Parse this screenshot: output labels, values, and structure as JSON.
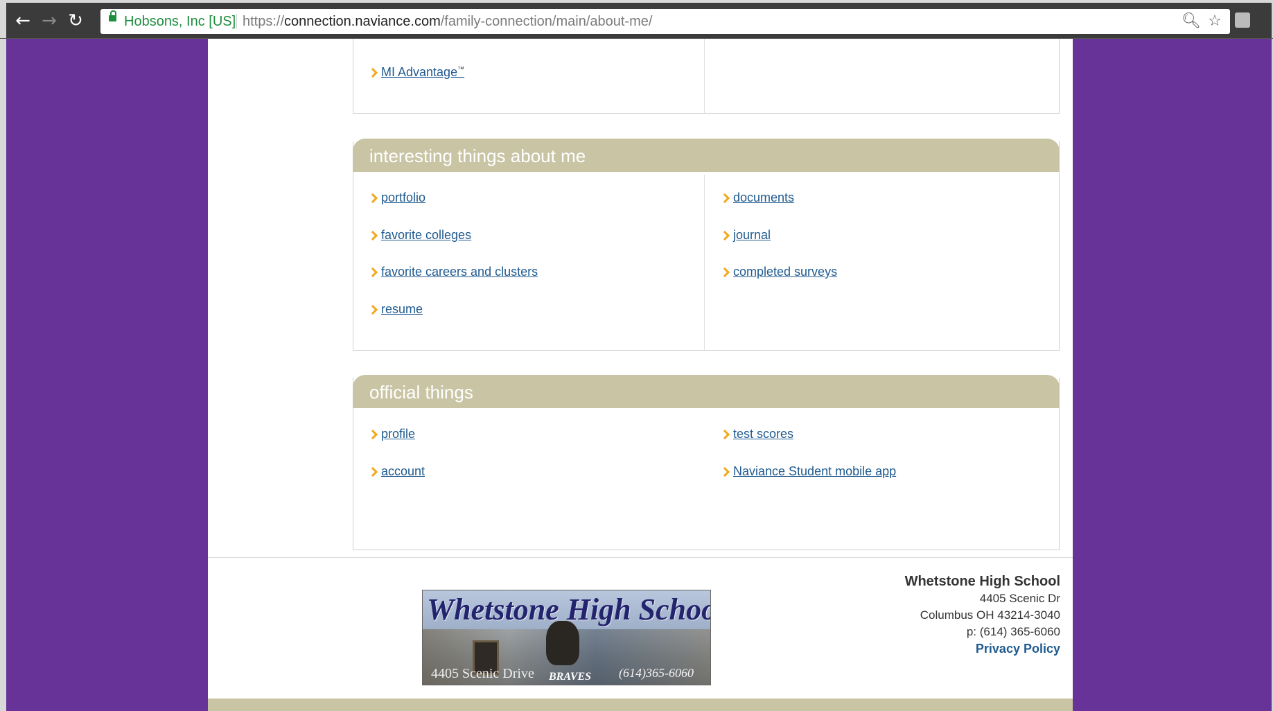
{
  "browser": {
    "back_icon": "arrow-left-icon",
    "forward_icon": "arrow-right-icon",
    "reload_icon": "reload-icon",
    "site_identity": "Hobsons, Inc [US]",
    "url_scheme": "https://",
    "url_host": "connection.naviance.com",
    "url_path": "/family-connection/main/about-me/",
    "zoom_icon": "magnifier-icon",
    "star_icon": "star-icon",
    "extension_icon": "extension-icon"
  },
  "top_box": {
    "items": [
      {
        "label": "MI Advantage",
        "mark": "™"
      }
    ]
  },
  "interesting": {
    "title": "interesting things about me",
    "left": [
      {
        "label": "portfolio"
      },
      {
        "label": "favorite colleges"
      },
      {
        "label": "favorite careers and clusters"
      },
      {
        "label": "resume"
      }
    ],
    "right": [
      {
        "label": "documents"
      },
      {
        "label": "journal"
      },
      {
        "label": "completed surveys"
      }
    ]
  },
  "official": {
    "title": "official things",
    "left": [
      {
        "label": "profile"
      },
      {
        "label": "account"
      }
    ],
    "right": [
      {
        "label": "test scores"
      },
      {
        "label": "Naviance Student mobile app"
      }
    ]
  },
  "footer": {
    "logo": {
      "title": "Whetstone High School",
      "address": "4405 Scenic Drive",
      "mascot": "BRAVES",
      "phone": "(614)365-6060"
    },
    "school_name": "Whetstone High School",
    "street": "4405 Scenic Dr",
    "city_line": "Columbus OH 43214-3040",
    "phone_line": "p: (614) 365-6060",
    "privacy_label": "Privacy Policy"
  },
  "colors": {
    "page_background": "#673399",
    "header_band": "#c8c4a4",
    "link": "#1f5a8f",
    "chevron": "#f0a81e"
  }
}
